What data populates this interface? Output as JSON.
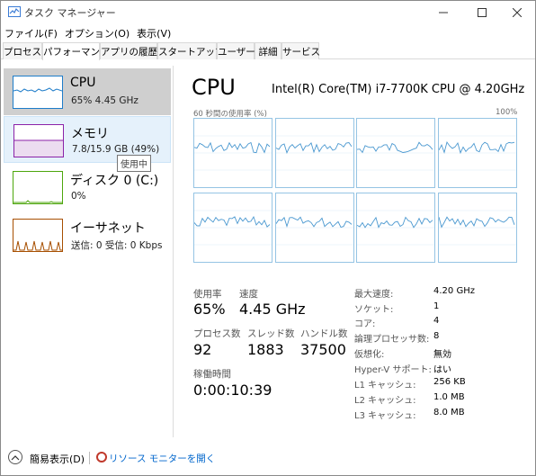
{
  "window": {
    "title": "タスク マネージャー"
  },
  "menu": [
    "ファイル(F)",
    "オプション(O)",
    "表示(V)"
  ],
  "tabs": [
    {
      "label": "プロセス",
      "active": false
    },
    {
      "label": "パフォーマンス",
      "active": true
    },
    {
      "label": "アプリの履歴",
      "active": false
    },
    {
      "label": "スタートアップ",
      "active": false
    },
    {
      "label": "ユーザー",
      "active": false
    },
    {
      "label": "詳細",
      "active": false
    },
    {
      "label": "サービス",
      "active": false
    }
  ],
  "sidebar": [
    {
      "name": "CPU",
      "sub": "65%  4.45 GHz",
      "color": "#1e7cc9"
    },
    {
      "name": "メモリ",
      "sub": "7.8/15.9 GB (49%)",
      "color": "#8b22a8"
    },
    {
      "name": "ディスク 0 (C:)",
      "sub": "0%",
      "color": "#4da60c"
    },
    {
      "name": "イーサネット",
      "sub": "送信: 0  受信: 0 Kbps",
      "color": "#a74f01"
    }
  ],
  "tooltip": "使用中",
  "detail": {
    "title": "CPU",
    "model": "Intel(R) Core(TM) i7-7700K CPU @ 4.20GHz",
    "graph_label": "60 秒間の使用率 (%)",
    "graph_max": "100%",
    "utilization_label": "使用率",
    "utilization_value": "65%",
    "speed_label": "速度",
    "speed_value": "4.45 GHz",
    "processes_label": "プロセス数",
    "processes_value": "92",
    "threads_label": "スレッド数",
    "threads_value": "1883",
    "handles_label": "ハンドル数",
    "handles_value": "37500",
    "uptime_label": "稼働時間",
    "uptime_value": "0:00:10:39",
    "specs": [
      {
        "label": "最大速度:",
        "value": "4.20 GHz"
      },
      {
        "label": "ソケット:",
        "value": "1"
      },
      {
        "label": "コア:",
        "value": "4"
      },
      {
        "label": "論理プロセッサ数:",
        "value": "8"
      },
      {
        "label": "仮想化:",
        "value": "無効"
      },
      {
        "label": "Hyper-V サポート:",
        "value": "はい"
      },
      {
        "label": "L1 キャッシュ:",
        "value": "256 KB"
      },
      {
        "label": "L2 キャッシュ:",
        "value": "1.0 MB"
      },
      {
        "label": "L3 キャッシュ:",
        "value": "8.0 MB"
      }
    ],
    "core_line_color": "#4a98d0",
    "core_grid_color": "#d9eaf7"
  },
  "footer": {
    "fewer_details": "簡易表示(D)",
    "open_monitor": "リソース モニターを開く"
  }
}
